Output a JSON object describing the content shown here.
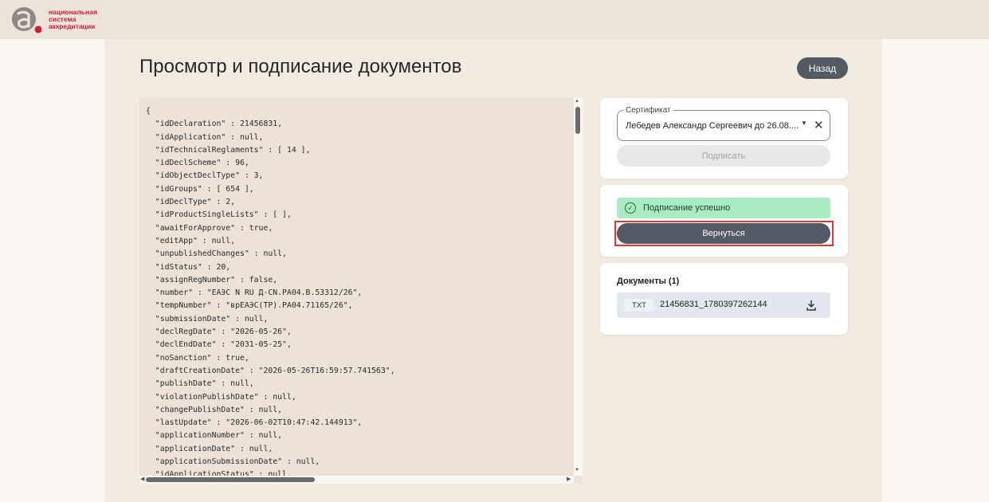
{
  "logo": {
    "lines": [
      "национальная",
      "система",
      "аккредитации"
    ]
  },
  "page": {
    "title": "Просмотр и подписание документов",
    "back_label": "Назад"
  },
  "document": {
    "lines": [
      "{",
      "  \"idDeclaration\" : 21456831,",
      "  \"idApplication\" : null,",
      "  \"idTechnicalReglaments\" : [ 14 ],",
      "  \"idDeclScheme\" : 96,",
      "  \"idObjectDeclType\" : 3,",
      "  \"idGroups\" : [ 654 ],",
      "  \"idDeclType\" : 2,",
      "  \"idProductSingleLists\" : [ ],",
      "  \"awaitForApprove\" : true,",
      "  \"editApp\" : null,",
      "  \"unpublishedChanges\" : null,",
      "  \"idStatus\" : 20,",
      "  \"assignRegNumber\" : false,",
      "  \"number\" : \"ЕАЭС N RU Д-CN.РА04.В.53312/26\",",
      "  \"tempNumber\" : \"врЕАЭС(ТР).РА04.71165/26\",",
      "  \"submissionDate\" : null,",
      "  \"declRegDate\" : \"2026-05-26\",",
      "  \"declEndDate\" : \"2031-05-25\",",
      "  \"noSanction\" : true,",
      "  \"draftCreationDate\" : \"2026-05-26T16:59:57.741563\",",
      "  \"publishDate\" : null,",
      "  \"violationPublishDate\" : null,",
      "  \"changePublishDate\" : null,",
      "  \"lastUpdate\" : \"2026-06-02T10:47:42.144913\",",
      "  \"applicationNumber\" : null,",
      "  \"applicationDate\" : null,",
      "  \"applicationSubmissionDate\" : null,",
      "  \"idApplicationStatus\" : null,"
    ]
  },
  "certificate": {
    "label": "Сертификат",
    "value": "Лебедев Александр Сергеевич до 26.08....",
    "sign_label": "Подписать"
  },
  "status": {
    "message": "Подписание успешно",
    "return_label": "Вернуться"
  },
  "documents": {
    "title": "Документы (1)",
    "items": [
      {
        "type": "TXT",
        "name": "21456831_1780397262144"
      }
    ]
  },
  "colors": {
    "accent": "#545a63",
    "brand": "#cf1e3c",
    "success": "#a9ecc4",
    "highlight": "#e03a2f"
  }
}
